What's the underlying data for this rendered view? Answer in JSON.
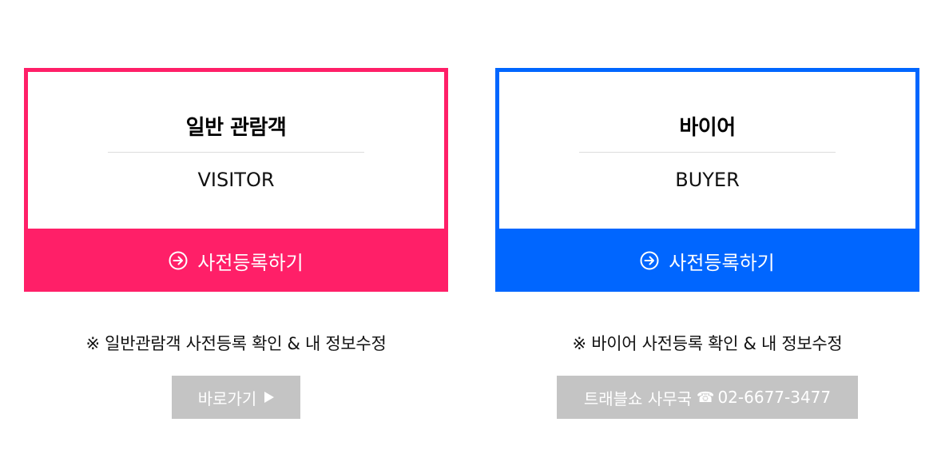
{
  "colors": {
    "visitor_accent": "#ff1f68",
    "buyer_accent": "#0066ff",
    "gray_button": "#c4c4c4"
  },
  "visitor": {
    "title": "일반 관람객",
    "subtitle": "VISITOR",
    "register_label": "사전등록하기",
    "register_icon": "arrow-circle-right-icon",
    "note": "※ 일반관람객 사전등록 확인 & 내 정보수정",
    "goto_label": "바로가기",
    "goto_icon": "play-icon"
  },
  "buyer": {
    "title": "바이어",
    "subtitle": "BUYER",
    "register_label": "사전등록하기",
    "register_icon": "arrow-circle-right-icon",
    "note": "※ 바이어 사전등록 확인 & 내 정보수정",
    "office_label": "트래블쇼 사무국",
    "office_icon": "phone-icon",
    "office_phone": "02-6677-3477"
  }
}
